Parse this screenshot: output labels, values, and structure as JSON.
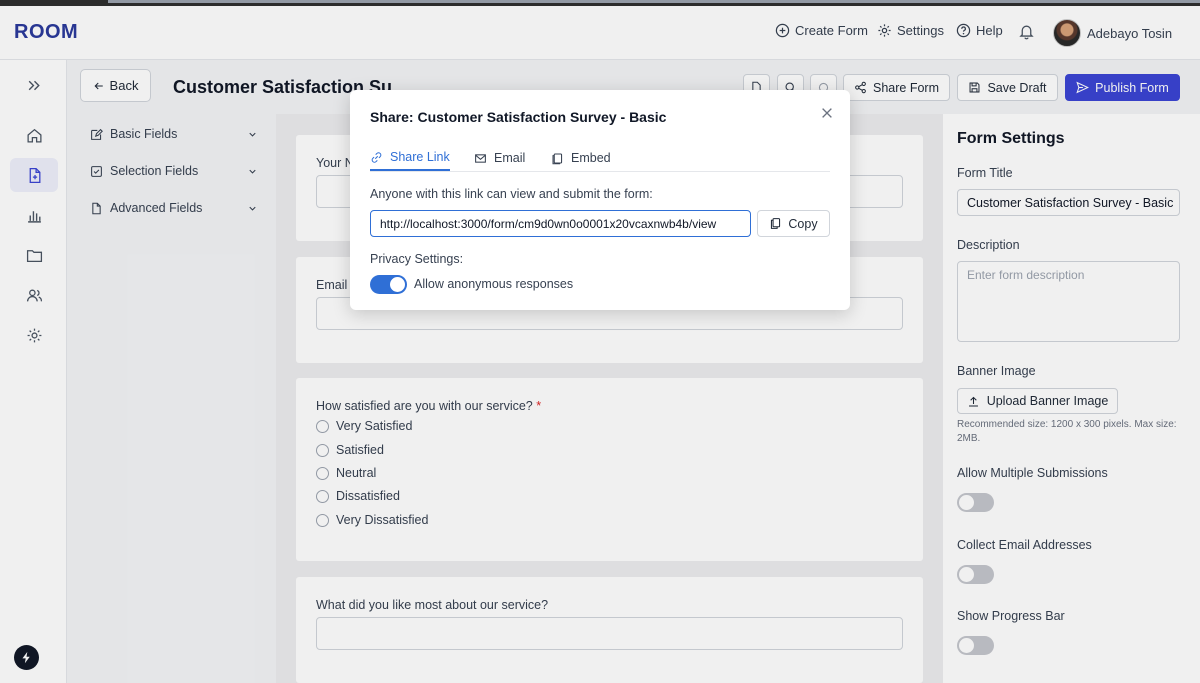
{
  "colors": {
    "brand": "#2b3a9c",
    "primary": "#3b45d4",
    "link": "#2f6fd6",
    "required": "#dc2626"
  },
  "navbar": {
    "logo": "ROOM",
    "create_form": "Create Form",
    "settings": "Settings",
    "help": "Help",
    "user_name": "Adebayo Tosin"
  },
  "sidebar": {
    "icons": [
      "expand-icon",
      "home-icon",
      "form-icon",
      "analytics-icon",
      "folder-icon",
      "users-icon",
      "settings-icon"
    ],
    "active": "form-icon"
  },
  "builder": {
    "back_label": "Back",
    "form_title": "Customer Satisfaction Su",
    "palette": [
      "Basic Fields",
      "Selection Fields",
      "Advanced Fields"
    ],
    "toolbar": {
      "share": "Share Form",
      "save": "Save Draft",
      "publish": "Publish Form"
    },
    "questions": {
      "name_label": "Your N",
      "email_label": "Email A",
      "satisfaction_label": "How satisfied are you with our service?",
      "required_mark": "*",
      "options": [
        "Very Satisfied",
        "Satisfied",
        "Neutral",
        "Dissatisfied",
        "Very Dissatisfied"
      ],
      "liked_label": "What did you like most about our service?"
    }
  },
  "settings_panel": {
    "title": "Form Settings",
    "form_title_label": "Form Title",
    "form_title_value": "Customer Satisfaction Survey - Basic",
    "description_label": "Description",
    "description_placeholder": "Enter form description",
    "banner_label": "Banner Image",
    "upload_label": "Upload Banner Image",
    "banner_hint": "Recommended size: 1200 x 300 pixels. Max size: 2MB.",
    "multiple_label": "Allow Multiple Submissions",
    "multiple_enabled": false,
    "collect_email_label": "Collect Email Addresses",
    "collect_email_enabled": false,
    "progress_label": "Show Progress Bar",
    "progress_enabled": false
  },
  "share_modal": {
    "title": "Share: Customer Satisfaction Survey - Basic",
    "tabs": [
      "Share Link",
      "Email",
      "Embed"
    ],
    "active_tab": "Share Link",
    "description": "Anyone with this link can view and submit the form:",
    "link": "http://localhost:3000/form/cm9d0wn0o0001x20vcaxnwb4b/view",
    "copy_label": "Copy",
    "privacy_label": "Privacy Settings:",
    "anonymous_label": "Allow anonymous responses",
    "anonymous_enabled": true
  }
}
